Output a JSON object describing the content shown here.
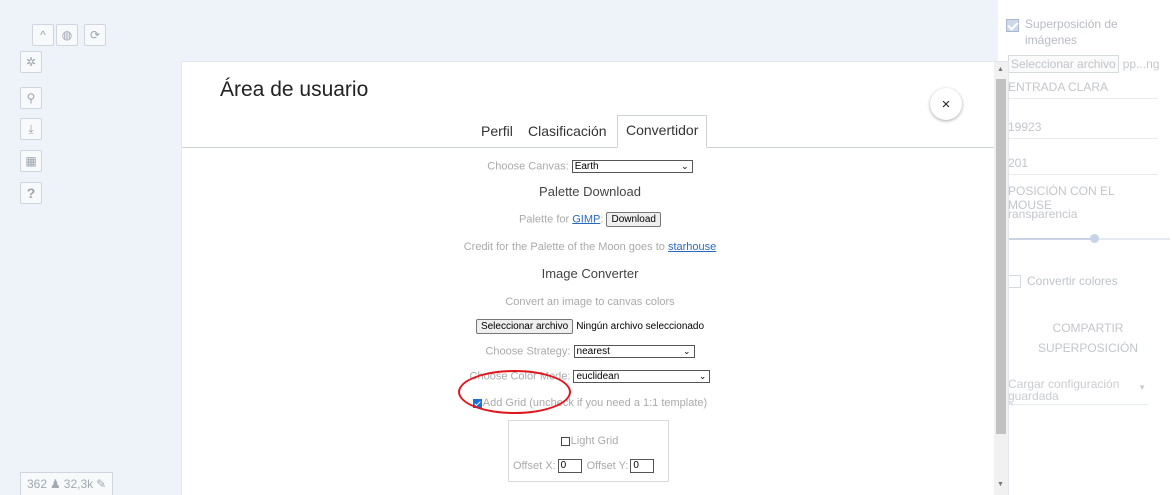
{
  "toolbar": {
    "icons": [
      "chevron-up-icon",
      "globe-icon",
      "sync-icon",
      "gear-icon",
      "user-icon",
      "download-icon",
      "pixel-art-icon",
      "help-icon"
    ],
    "help_label": "?"
  },
  "bottom_stats": {
    "online": "362",
    "pixels": "32,3k"
  },
  "side_panel": {
    "overlay_label": "Superposición de imágenes",
    "file_button": "Seleccionar archivo",
    "file_name": "pp...ng",
    "entry_label": "ENTRADA CLARA",
    "value1": "19923",
    "value2": "201",
    "mouse_position_label": "POSICIÓN CON EL MOUSE",
    "transparency_label": "ransparencia",
    "transparency_value": 0.52,
    "convert_colors_label": "Convertir colores",
    "share_label": "COMPARTIR SUPERPOSICIÓN",
    "load_config_label": "Cargar configuración guardada"
  },
  "modal": {
    "title": "Área de usuario",
    "close_label": "×",
    "tabs": [
      "Perfil",
      "Clasificación",
      "Convertidor"
    ],
    "active_tab": "Convertidor"
  },
  "converter": {
    "choose_canvas_label": "Choose Canvas:",
    "canvas_value": "Earth",
    "palette_download_heading": "Palette Download",
    "palette_for_text": "Palette for",
    "gimp_link": "GIMP",
    "colon": ":",
    "download_button": "Download",
    "credit_text": "Credit for the Palette of the Moon goes to",
    "starhouse_link": "starhouse",
    "image_converter_heading": "Image Converter",
    "convert_desc": "Convert an image to canvas colors",
    "file_button": "Seleccionar archivo",
    "no_file_text": "Ningún archivo seleccionado",
    "strategy_label": "Choose Strategy:",
    "strategy_value": "nearest",
    "color_mode_label": "Choose Color Mode:",
    "color_mode_value": "euclidean",
    "add_grid_label": "Add Grid (uncheck if you need a 1:1 template)",
    "light_grid_label": "Light Grid",
    "offset_x_label": "Offset X:",
    "offset_x_value": "0",
    "offset_y_label": "Offset Y:",
    "offset_y_value": "0"
  },
  "colors": {
    "accent": "#2b6bbf",
    "annotation": "#e0161d",
    "checkbox": "#1a6fd8"
  }
}
